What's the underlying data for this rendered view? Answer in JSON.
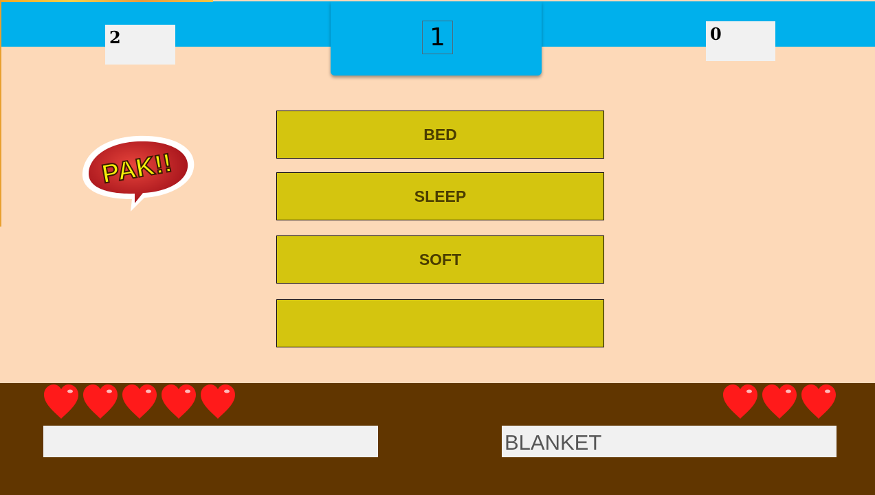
{
  "header": {
    "left_score": "2",
    "right_score": "0",
    "round": "1"
  },
  "clue_words": [
    "BED",
    "SLEEP",
    "SOFT",
    ""
  ],
  "effect_bubble": {
    "text": "PAK!!",
    "icon": "speech-bubble-icon"
  },
  "players": {
    "left": {
      "lives": 5,
      "answer": ""
    },
    "right": {
      "lives": 3,
      "answer": "BLANKET"
    }
  },
  "colors": {
    "background": "#fdd9b8",
    "top_bar": "#00b0ec",
    "word_slot": "#d4c50f",
    "bottom_panel": "#613600",
    "heart": "#ff1a1a"
  }
}
